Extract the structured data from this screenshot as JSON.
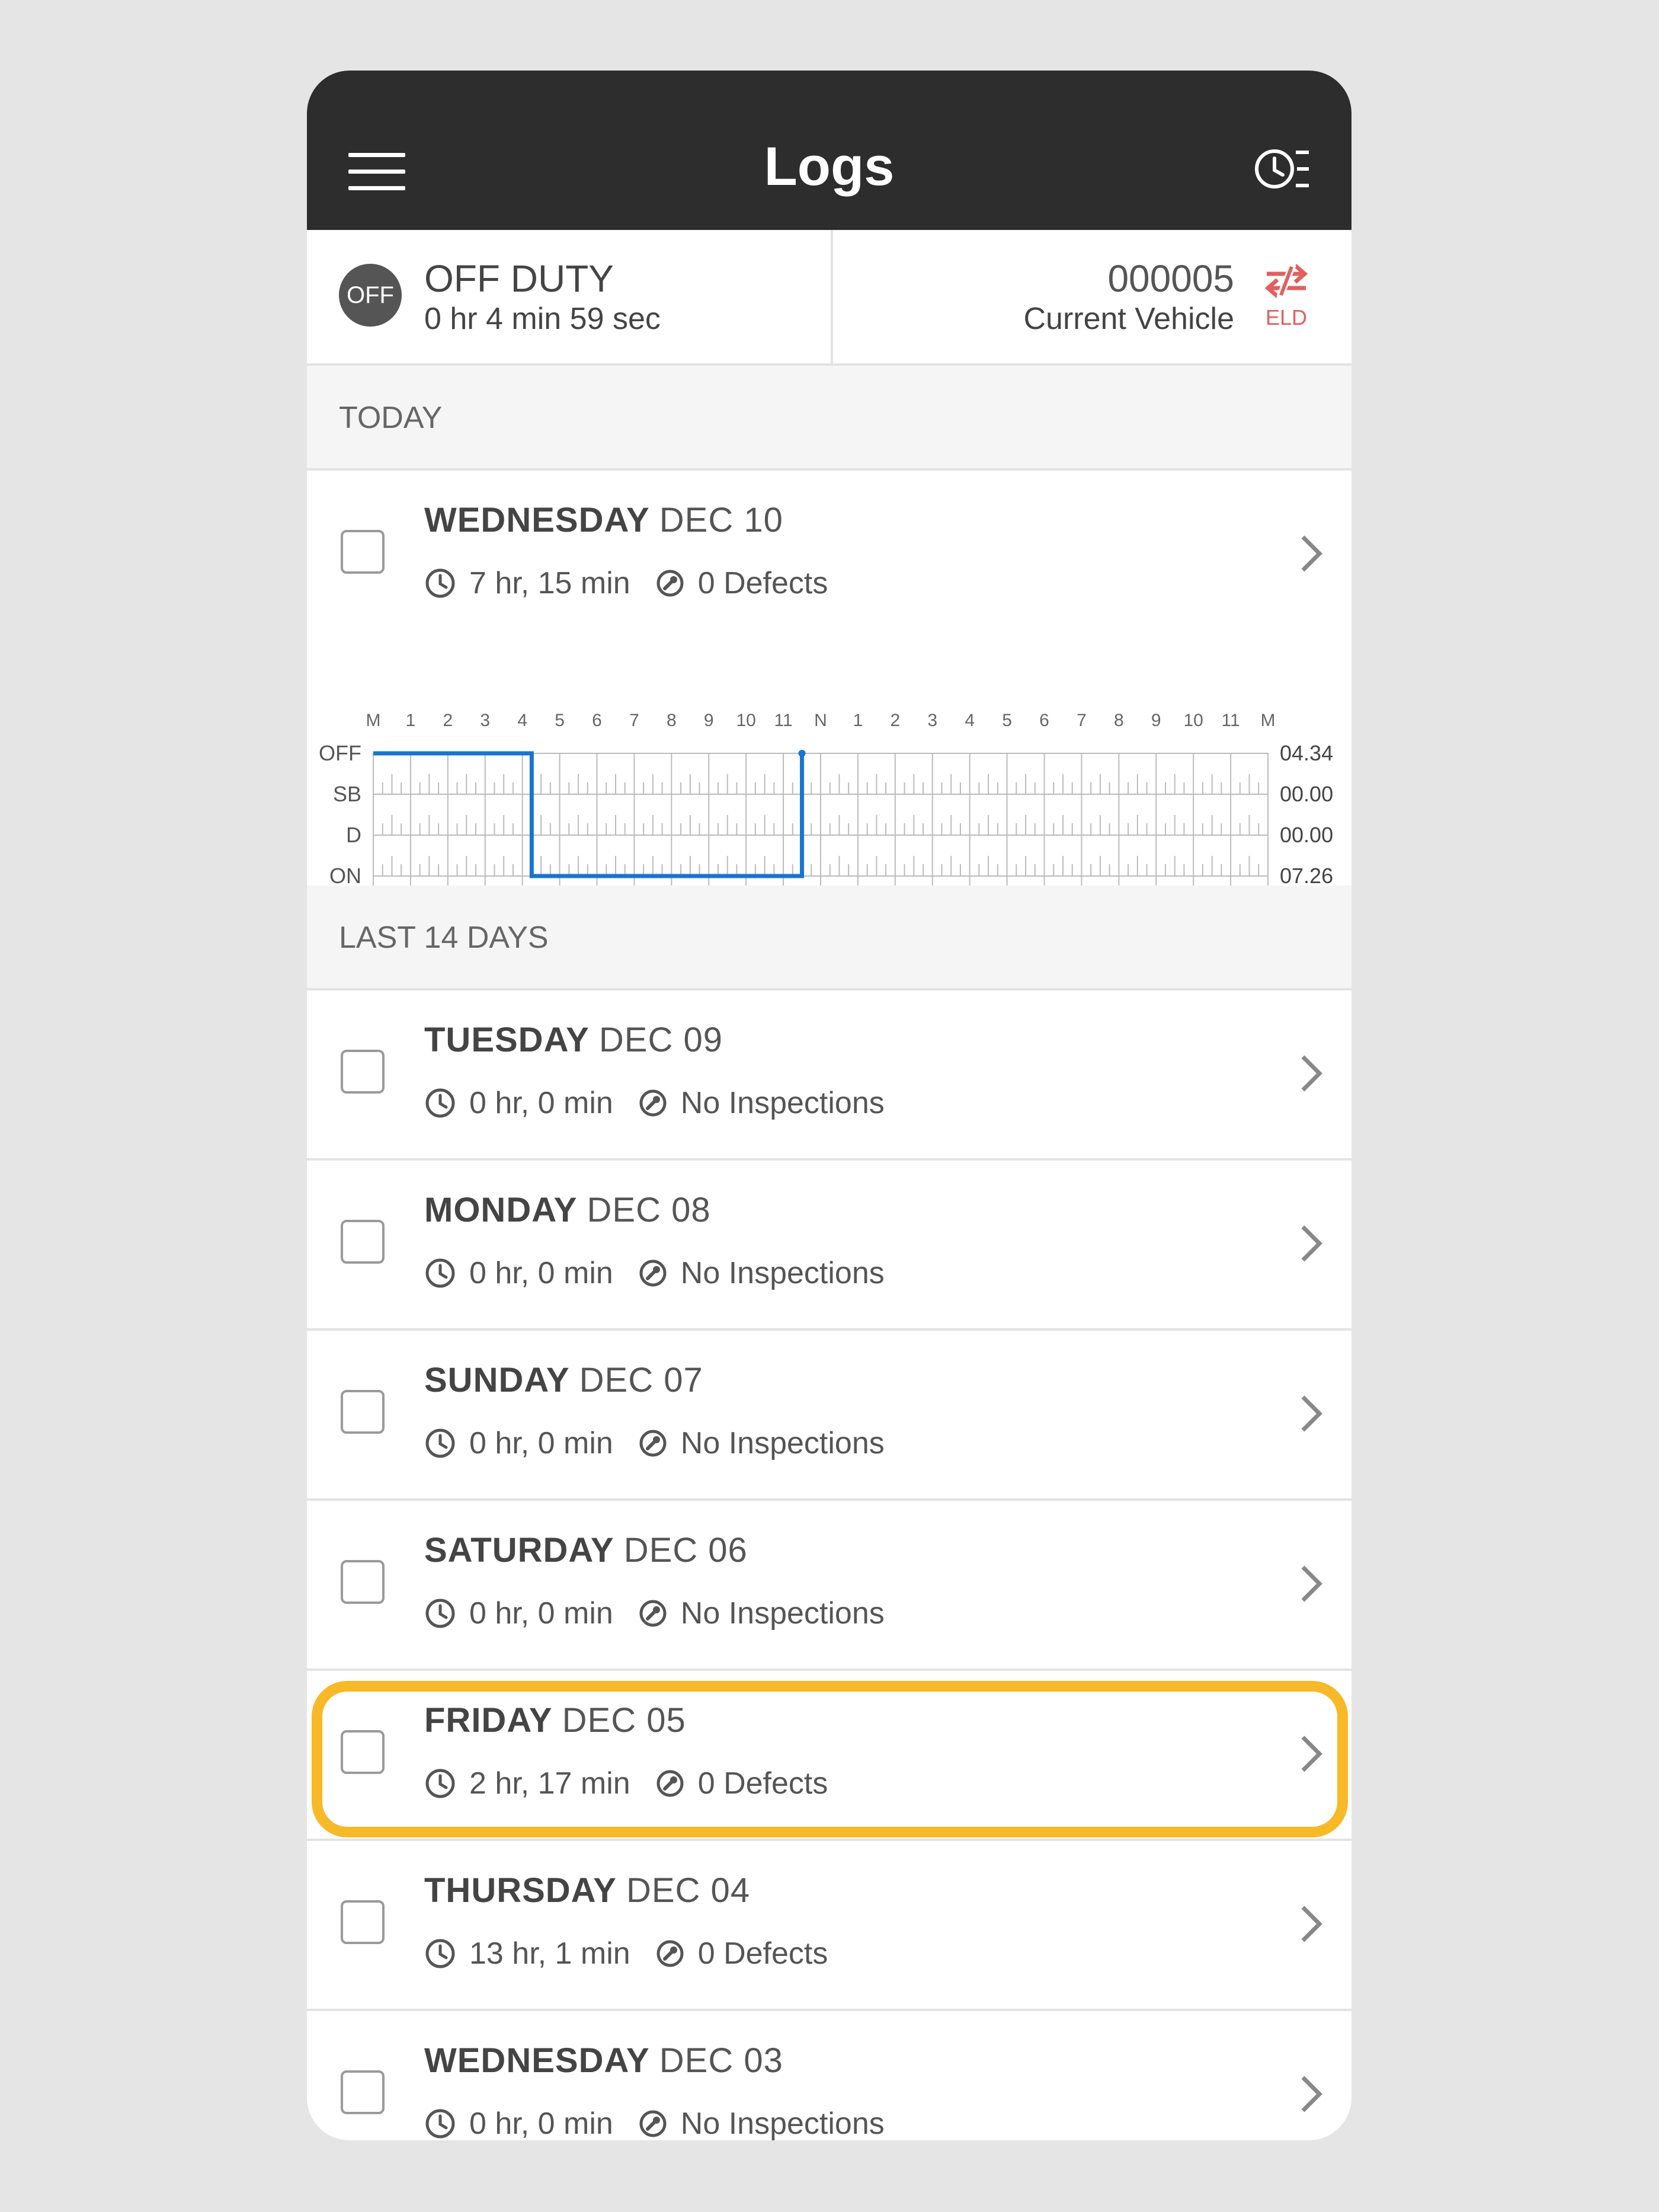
{
  "header": {
    "title": "Logs",
    "menu_icon": "menu-icon",
    "history_icon": "clock-list-icon"
  },
  "status": {
    "badge": "OFF",
    "duty_label": "OFF DUTY",
    "duty_time": "0 hr 4 min 59 sec",
    "vehicle_id": "000005",
    "vehicle_label": "Current Vehicle",
    "eld_label": "ELD",
    "eld_color": "#e06060"
  },
  "today": {
    "section_label": "TODAY",
    "day": "WEDNESDAY",
    "date": "DEC 10",
    "duration": "7 hr, 15 min",
    "inspection": "0 Defects"
  },
  "graph": {
    "hour_labels": [
      "M",
      "1",
      "2",
      "3",
      "4",
      "5",
      "6",
      "7",
      "8",
      "9",
      "10",
      "11",
      "N",
      "1",
      "2",
      "3",
      "4",
      "5",
      "6",
      "7",
      "8",
      "9",
      "10",
      "11",
      "M"
    ],
    "status_labels": [
      "OFF",
      "SB",
      "D",
      "ON"
    ],
    "totals": [
      "04.34",
      "00.00",
      "00.00",
      "07.26"
    ],
    "line_color": "#1a73d1",
    "segments": [
      {
        "status": "OFF",
        "from_hour": 0,
        "to_hour": 4.25
      },
      {
        "status": "ON",
        "from_hour": 4.25,
        "to_hour": 11.5
      },
      {
        "status": "OFF",
        "from_hour": 11.5,
        "to_hour": 11.5
      }
    ]
  },
  "last14": {
    "section_label": "LAST 14 DAYS",
    "rows": [
      {
        "day": "TUESDAY",
        "date": "DEC 09",
        "duration": "0 hr, 0 min",
        "inspection": "No Inspections"
      },
      {
        "day": "MONDAY",
        "date": "DEC 08",
        "duration": "0 hr, 0 min",
        "inspection": "No Inspections"
      },
      {
        "day": "SUNDAY",
        "date": "DEC 07",
        "duration": "0 hr, 0 min",
        "inspection": "No Inspections"
      },
      {
        "day": "SATURDAY",
        "date": "DEC 06",
        "duration": "0 hr, 0 min",
        "inspection": "No Inspections"
      },
      {
        "day": "FRIDAY",
        "date": "DEC 05",
        "duration": "2 hr, 17 min",
        "inspection": "0 Defects"
      },
      {
        "day": "THURSDAY",
        "date": "DEC 04",
        "duration": "13 hr, 1 min",
        "inspection": "0 Defects"
      },
      {
        "day": "WEDNESDAY",
        "date": "DEC 03",
        "duration": "0 hr, 0 min",
        "inspection": "No Inspections"
      }
    ]
  },
  "highlight_color": "#f7b928"
}
